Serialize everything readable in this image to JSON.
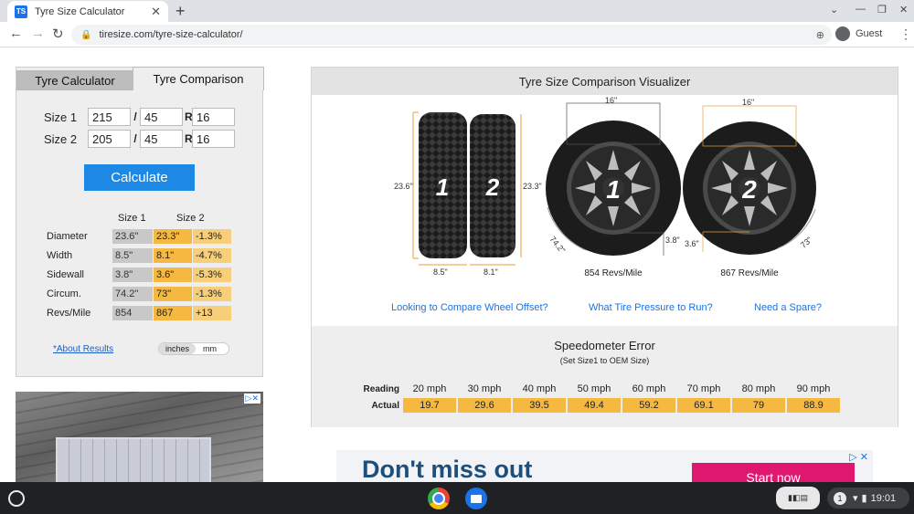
{
  "browser": {
    "tab_title": "Tyre Size Calculator",
    "favicon_text": "TS",
    "url": "tiresize.com/tyre-size-calculator/",
    "profile_label": "Guest"
  },
  "calculator": {
    "tabs": [
      "Tyre Calculator",
      "Tyre Comparison"
    ],
    "size1": {
      "label": "Size 1",
      "width": "215",
      "ratio": "45",
      "rim": "16"
    },
    "size2": {
      "label": "Size 2",
      "width": "205",
      "ratio": "45",
      "rim": "16"
    },
    "slash": "/",
    "r": "R",
    "calculate_label": "Calculate",
    "col_size1": "Size 1",
    "col_size2": "Size 2",
    "rows": [
      {
        "label": "Diameter",
        "s1": "23.6\"",
        "s2": "23.3\"",
        "diff": "-1.3%"
      },
      {
        "label": "Width",
        "s1": "8.5\"",
        "s2": "8.1\"",
        "diff": "-4.7%"
      },
      {
        "label": "Sidewall",
        "s1": "3.8\"",
        "s2": "3.6\"",
        "diff": "-5.3%"
      },
      {
        "label": "Circum.",
        "s1": "74.2\"",
        "s2": "73\"",
        "diff": "-1.3%"
      },
      {
        "label": "Revs/Mile",
        "s1": "854",
        "s2": "867",
        "diff": "+13"
      }
    ],
    "about_link": "*About Results",
    "unit_inches": "inches",
    "unit_mm": "mm"
  },
  "visualizer": {
    "title": "Tyre Size Comparison Visualizer",
    "tyre1": {
      "num": "1",
      "diameter": "23.6\"",
      "width": "8.5\"",
      "rim": "16\"",
      "sidewall": "3.8\"",
      "circum": "74.2\"",
      "revs": "854 Revs/Mile"
    },
    "tyre2": {
      "num": "2",
      "diameter": "23.3\"",
      "width": "8.1\"",
      "rim": "16\"",
      "sidewall": "3.6\"",
      "circum": "73\"",
      "revs": "867 Revs/Mile"
    },
    "links": [
      "Looking to Compare Wheel Offset?",
      "What Tire Pressure to Run?",
      "Need a Spare?"
    ]
  },
  "speedometer": {
    "title": "Speedometer Error",
    "subtitle": "(Set Size1 to OEM Size)",
    "reading_label": "Reading",
    "actual_label": "Actual",
    "reading": [
      "20 mph",
      "30 mph",
      "40 mph",
      "50 mph",
      "60 mph",
      "70 mph",
      "80 mph",
      "90 mph"
    ],
    "actual": [
      "19.7",
      "29.6",
      "39.5",
      "49.4",
      "59.2",
      "69.1",
      "79",
      "88.9"
    ]
  },
  "ad_bottom": {
    "headline": "Don't miss out",
    "cta": "Start now"
  },
  "shelf": {
    "time": "19:01",
    "notif_count": "1"
  }
}
